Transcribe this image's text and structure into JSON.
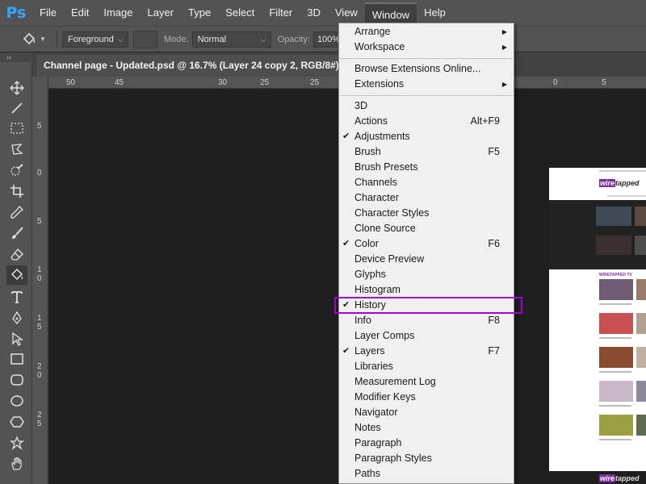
{
  "app": {
    "logo": "Ps"
  },
  "menubar": {
    "items": [
      "File",
      "Edit",
      "Image",
      "Layer",
      "Type",
      "Select",
      "Filter",
      "3D",
      "View",
      "Window",
      "Help"
    ]
  },
  "options": {
    "fill_source": "Foreground",
    "mode_label": "Mode:",
    "mode_value": "Normal",
    "opacity_label": "Opacity:",
    "opacity_value": "100%"
  },
  "panel_toggle": "››",
  "document_tab": {
    "title": "Channel page - Updated.psd @ 16.7% (Layer 24 copy 2, RGB/8#) *",
    "close": "×"
  },
  "ruler": {
    "top_labels": [
      "50",
      "45",
      "30",
      "25",
      "0",
      "5"
    ],
    "left_labels": [
      "5",
      "0",
      "5",
      "1 0",
      "1 5",
      "2 0",
      "2 5"
    ]
  },
  "window_menu": {
    "items": [
      {
        "label": "Arrange",
        "submenu": true
      },
      {
        "label": "Workspace",
        "submenu": true
      },
      {
        "separator": true
      },
      {
        "label": "Browse Extensions Online..."
      },
      {
        "label": "Extensions",
        "submenu": true
      },
      {
        "separator": true
      },
      {
        "label": "3D"
      },
      {
        "label": "Actions",
        "shortcut": "Alt+F9"
      },
      {
        "label": "Adjustments",
        "checked": true
      },
      {
        "label": "Brush",
        "shortcut": "F5"
      },
      {
        "label": "Brush Presets"
      },
      {
        "label": "Channels"
      },
      {
        "label": "Character"
      },
      {
        "label": "Character Styles"
      },
      {
        "label": "Clone Source"
      },
      {
        "label": "Color",
        "checked": true,
        "shortcut": "F6"
      },
      {
        "label": "Device Preview"
      },
      {
        "label": "Glyphs"
      },
      {
        "label": "Histogram"
      },
      {
        "label": "History",
        "checked": true,
        "highlighted": true
      },
      {
        "label": "Info",
        "shortcut": "F8"
      },
      {
        "label": "Layer Comps"
      },
      {
        "label": "Layers",
        "checked": true,
        "shortcut": "F7"
      },
      {
        "label": "Libraries"
      },
      {
        "label": "Measurement Log"
      },
      {
        "label": "Modifier Keys"
      },
      {
        "label": "Navigator"
      },
      {
        "label": "Notes"
      },
      {
        "label": "Paragraph"
      },
      {
        "label": "Paragraph Styles"
      },
      {
        "label": "Paths"
      }
    ]
  },
  "preview": {
    "logo_a": "wire",
    "logo_b": "tapped",
    "section": "WIRETAPPED TV"
  },
  "colors": {
    "highlight": "#a000d6",
    "brand": "#7a2ca0",
    "ps_blue": "#31a8ff"
  }
}
